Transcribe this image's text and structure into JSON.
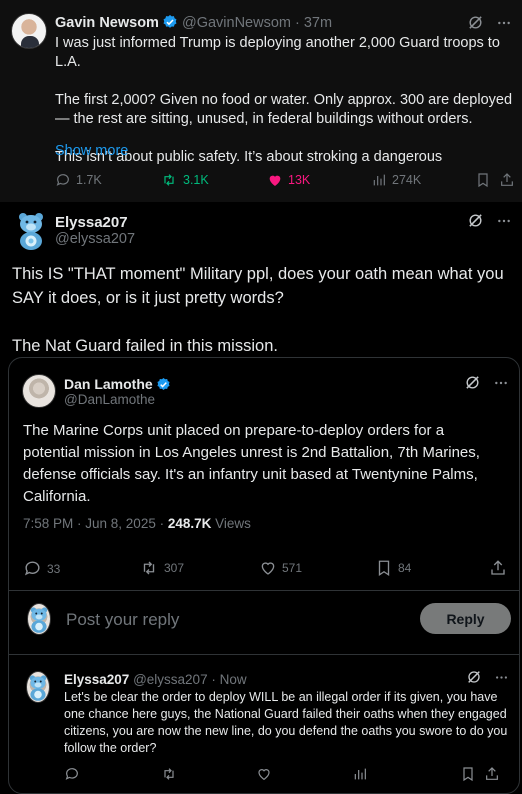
{
  "colors": {
    "accent": "#1d9bf0",
    "like_pink": "#f91880",
    "retweet_green": "#00ba7c",
    "muted": "#71767b",
    "text": "#e7e9ea"
  },
  "top_tweet": {
    "name": "Gavin Newsom",
    "handle": "@GavinNewsom",
    "time": "· 37m",
    "paragraphs": [
      "I was just informed Trump is deploying another 2,000 Guard troops to L.A.",
      "The first 2,000? Given no food or water. Only approx. 300 are deployed — the rest are sitting, unused, in federal buildings without orders.",
      "This isn’t about public safety. It’s about stroking a dangerous"
    ],
    "show_more": "Show more",
    "stats": {
      "replies": "1.7K",
      "retweets": "3.1K",
      "likes": "13K",
      "views": "274K"
    },
    "icons": [
      "grok-icon",
      "more-icon",
      "reply-icon",
      "retweet-icon",
      "heart-icon",
      "views-icon",
      "bookmark-icon",
      "share-icon"
    ]
  },
  "main_post": {
    "name": "Elyssa207",
    "handle": "@elyssa207",
    "paragraphs": [
      "This IS \"THAT moment\" Military ppl, does your oath mean what you SAY it does, or is it just pretty words?",
      "The Nat Guard failed in this mission."
    ]
  },
  "quoted": {
    "name": "Dan Lamothe",
    "handle": "@DanLamothe",
    "text": "The Marine Corps unit placed on prepare-to-deploy orders for a potential mission in Los Angeles unrest is 2nd Battalion, 7th Marines, defense officials say. It's an infantry unit based at Twentynine Palms, California.",
    "time": "7:58 PM · Jun 8, 2025 · ",
    "views_count": "248.7K",
    "views_label": " Views",
    "stats": {
      "replies": "33",
      "retweets": "307",
      "likes": "571",
      "bookmarks": "84"
    }
  },
  "reply_box": {
    "placeholder": "Post your reply",
    "button": "Reply"
  },
  "nested_reply": {
    "name": "Elyssa207",
    "handle": "@elyssa207",
    "time": "· Now",
    "text": "Let's be clear the order to deploy WILL be an illegal order if its given, you have one chance here guys, the National Guard failed their oaths when they engaged citizens, you are now the new line, do you defend the oaths you swore to do you follow the order?"
  }
}
